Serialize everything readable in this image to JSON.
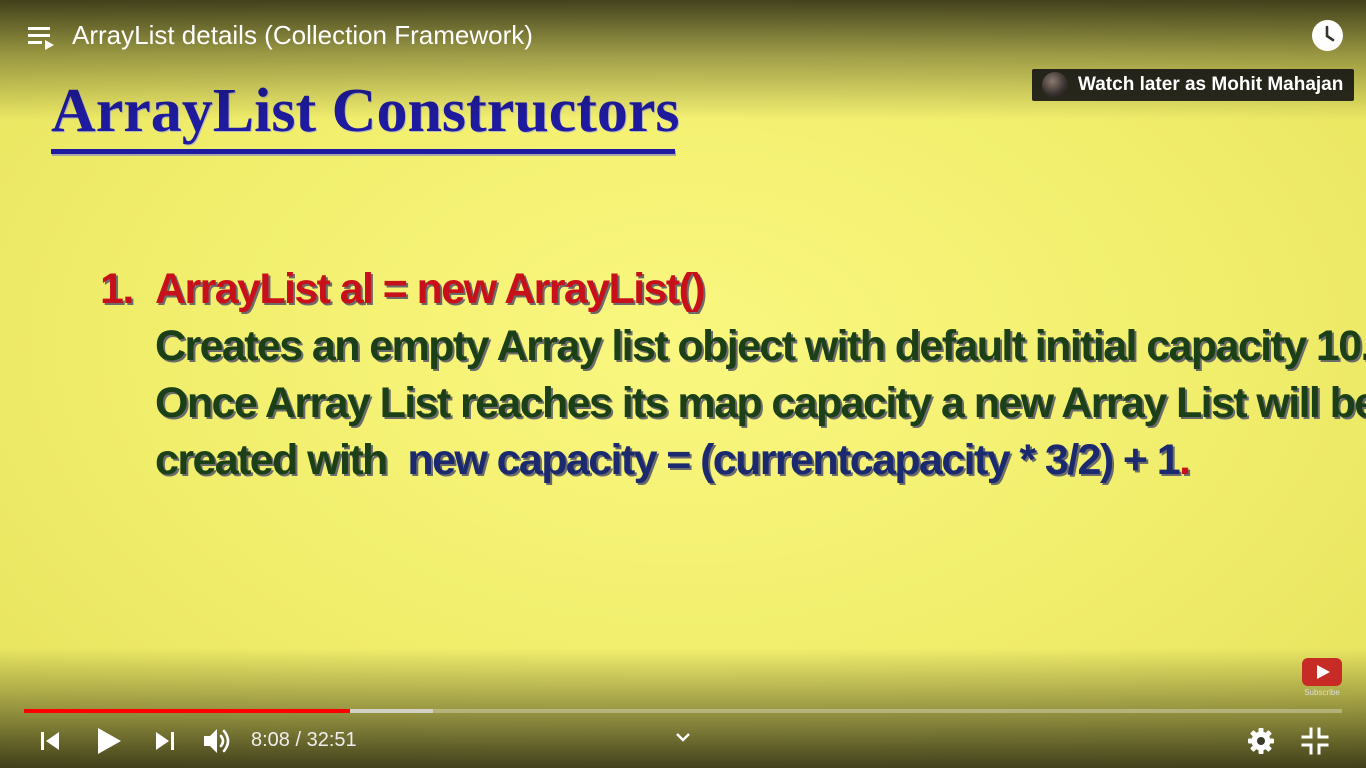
{
  "video": {
    "title": "ArrayList details (Collection Framework)"
  },
  "watch_later": {
    "label": "Watch later as Mohit Mahajan"
  },
  "slide": {
    "heading": "ArrayList Constructors",
    "item_number": "1.",
    "code_line": "ArrayList al = new ArrayList()",
    "desc_line1": "Creates an empty Array list object with default initial capacity 10.",
    "desc_line2": "Once Array List reaches its map capacity a new Array List will be",
    "desc_line3_prefix": "created with  ",
    "desc_line3_formula": "new capacity = (currentcapacity * 3/2) + 1",
    "desc_line3_end": "."
  },
  "subscribe": {
    "label": "Subscribe"
  },
  "controls": {
    "current_time": "8:08",
    "separator": " / ",
    "duration": "32:51",
    "played_fraction": 0.247,
    "buffered_fraction": 0.31
  },
  "icons": {
    "playlist": "playlist-icon",
    "watch_later": "clock-icon",
    "previous": "previous-icon",
    "play": "play-icon",
    "next": "next-icon",
    "volume": "volume-icon",
    "expand": "chevron-down-icon",
    "settings": "gear-icon",
    "exit_fullscreen": "exit-fullscreen-icon"
  },
  "colors": {
    "slide_background": "#f3f06e",
    "heading": "#1f1ba0",
    "code_red": "#c8101a",
    "text_green": "#1b3f16",
    "formula_navy": "#1b2a6e",
    "progress_played": "#ff0000"
  }
}
